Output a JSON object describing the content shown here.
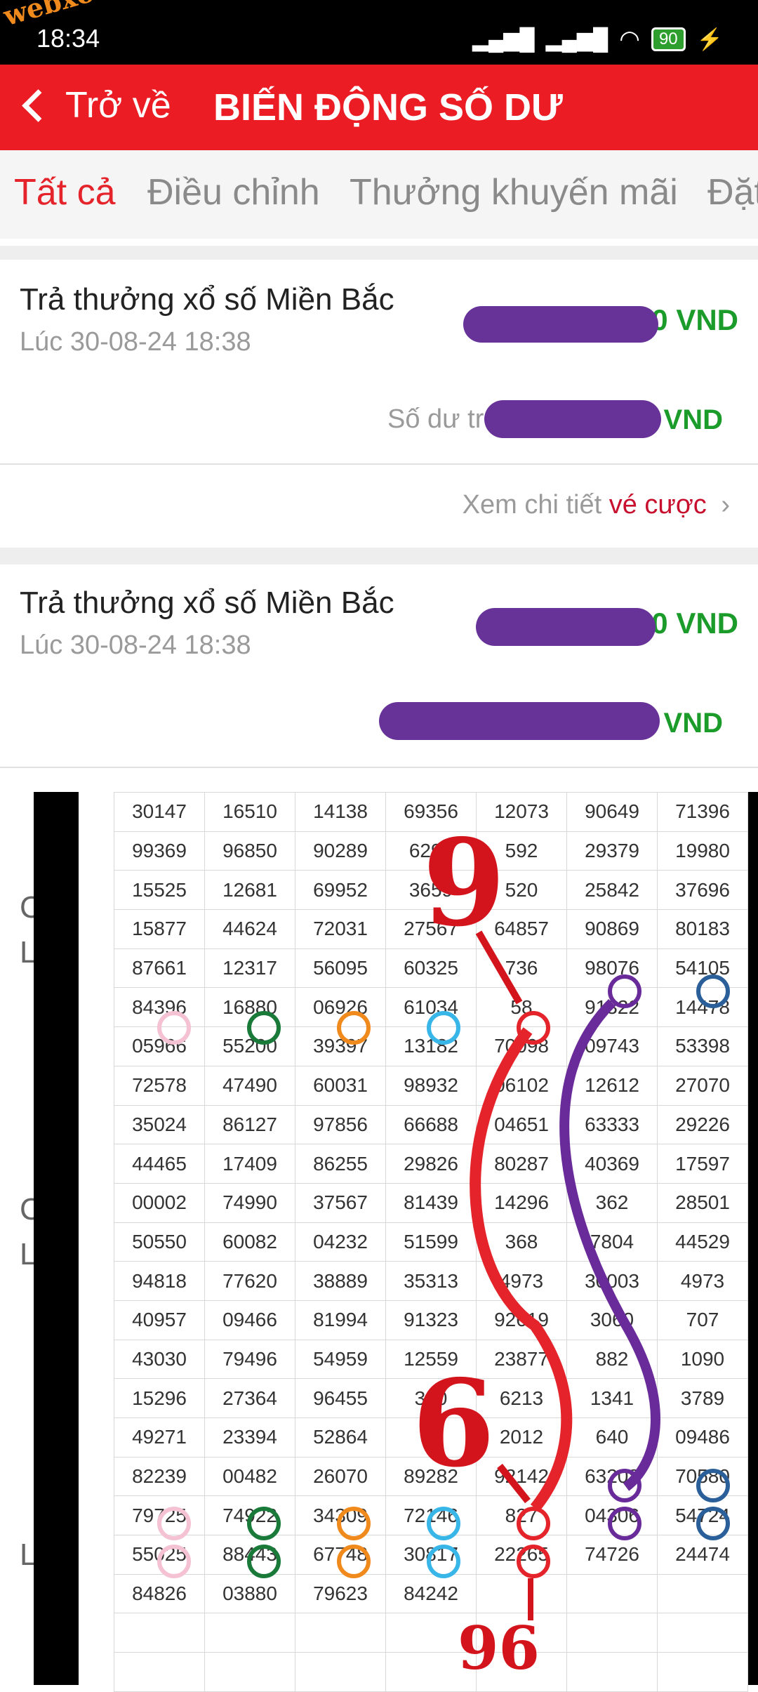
{
  "status_bar": {
    "time": "18:34",
    "battery": "90",
    "icons": [
      "mute-icon",
      "alarm-icon",
      "notification-icon",
      "signal-icon",
      "signal-icon",
      "wifi-icon",
      "battery-icon",
      "charging-icon"
    ]
  },
  "watermark": "webxoso.net",
  "header": {
    "back_label": "Trở về",
    "title": "BIẾN ĐỘNG SỐ DƯ"
  },
  "tabs": [
    "Tất cả",
    "Điều chỉnh",
    "Thưởng khuyến mãi",
    "Đặt"
  ],
  "transactions": [
    {
      "title": "Trả thưởng xổ số Miền Bắc",
      "time": "Lúc 30-08-24 18:38",
      "amount_suffix": "0 VND",
      "balance_label": "Số dư tr",
      "balance_suffix": "VND",
      "detail_prefix": "Xem chi tiết ",
      "detail_link": "vé cược"
    },
    {
      "title": "Trả thưởng xổ số Miền Bắc",
      "time": "Lúc 30-08-24 18:38",
      "amount_suffix": "0 VND",
      "balance_suffix": "VND"
    }
  ],
  "background_fragments": [
    "C",
    "L",
    "C",
    "L",
    "L"
  ],
  "lottery_table": [
    [
      "30147",
      "16510",
      "14138",
      "69356",
      "12073",
      "90649",
      "71396"
    ],
    [
      "99369",
      "96850",
      "90289",
      "6290",
      "592",
      "29379",
      "19980"
    ],
    [
      "15525",
      "12681",
      "69952",
      "3659",
      "520",
      "25842",
      "37696"
    ],
    [
      "15877",
      "44624",
      "72031",
      "27567",
      "64857",
      "90869",
      "80183"
    ],
    [
      "87661",
      "12317",
      "56095",
      "60325",
      "736",
      "98076",
      "54105"
    ],
    [
      "84396",
      "16880",
      "06926",
      "61034",
      "58",
      "91322",
      "14478"
    ],
    [
      "05966",
      "55200",
      "39397",
      "13182",
      "70098",
      "09743",
      "53398"
    ],
    [
      "72578",
      "47490",
      "60031",
      "98932",
      "06102",
      "12612",
      "27070"
    ],
    [
      "35024",
      "86127",
      "97856",
      "66688",
      "04651",
      "63333",
      "29226"
    ],
    [
      "44465",
      "17409",
      "86255",
      "29826",
      "80287",
      "40369",
      "17597"
    ],
    [
      "00002",
      "74990",
      "37567",
      "81439",
      "14296",
      "362",
      "28501"
    ],
    [
      "50550",
      "60082",
      "04232",
      "51599",
      "368",
      "7804",
      "44529"
    ],
    [
      "94818",
      "77620",
      "38889",
      "35313",
      "4973",
      "30003",
      "4973"
    ],
    [
      "40957",
      "09466",
      "81994",
      "91323",
      "92619",
      "3060",
      "707"
    ],
    [
      "43030",
      "79496",
      "54959",
      "12559",
      "23877",
      "882",
      "1090"
    ],
    [
      "15296",
      "27364",
      "96455",
      "360",
      "6213",
      "1341",
      "3789"
    ],
    [
      "49271",
      "23394",
      "52864",
      "98",
      "2012",
      "640",
      "09486"
    ],
    [
      "82239",
      "00482",
      "26070",
      "89282",
      "92142",
      "63208",
      "70580"
    ],
    [
      "79725",
      "74922",
      "34309",
      "72146",
      "827",
      "04306",
      "54724"
    ],
    [
      "55025",
      "88443",
      "67748",
      "30817",
      "22265",
      "74726",
      "24474"
    ],
    [
      "84826",
      "03880",
      "79623",
      "84242",
      "",
      "",
      ""
    ],
    [
      "",
      "",
      "",
      "",
      "",
      "",
      ""
    ],
    [
      "",
      "",
      "",
      "",
      "",
      "",
      ""
    ]
  ],
  "annotations": {
    "top": "9",
    "middle": "6",
    "bottom": "96"
  },
  "colors": {
    "header_red": "#ec1c24",
    "amount_green": "#1a9b2a",
    "link_red": "#c8102e",
    "marker_purple": "#673399",
    "circle_pink": "#f4c2d2",
    "circle_green": "#1a7a3a",
    "circle_orange": "#f08a1c",
    "circle_cyan": "#39b6e8",
    "circle_purple": "#6a2b9a",
    "circle_blue": "#2a5f9a"
  }
}
